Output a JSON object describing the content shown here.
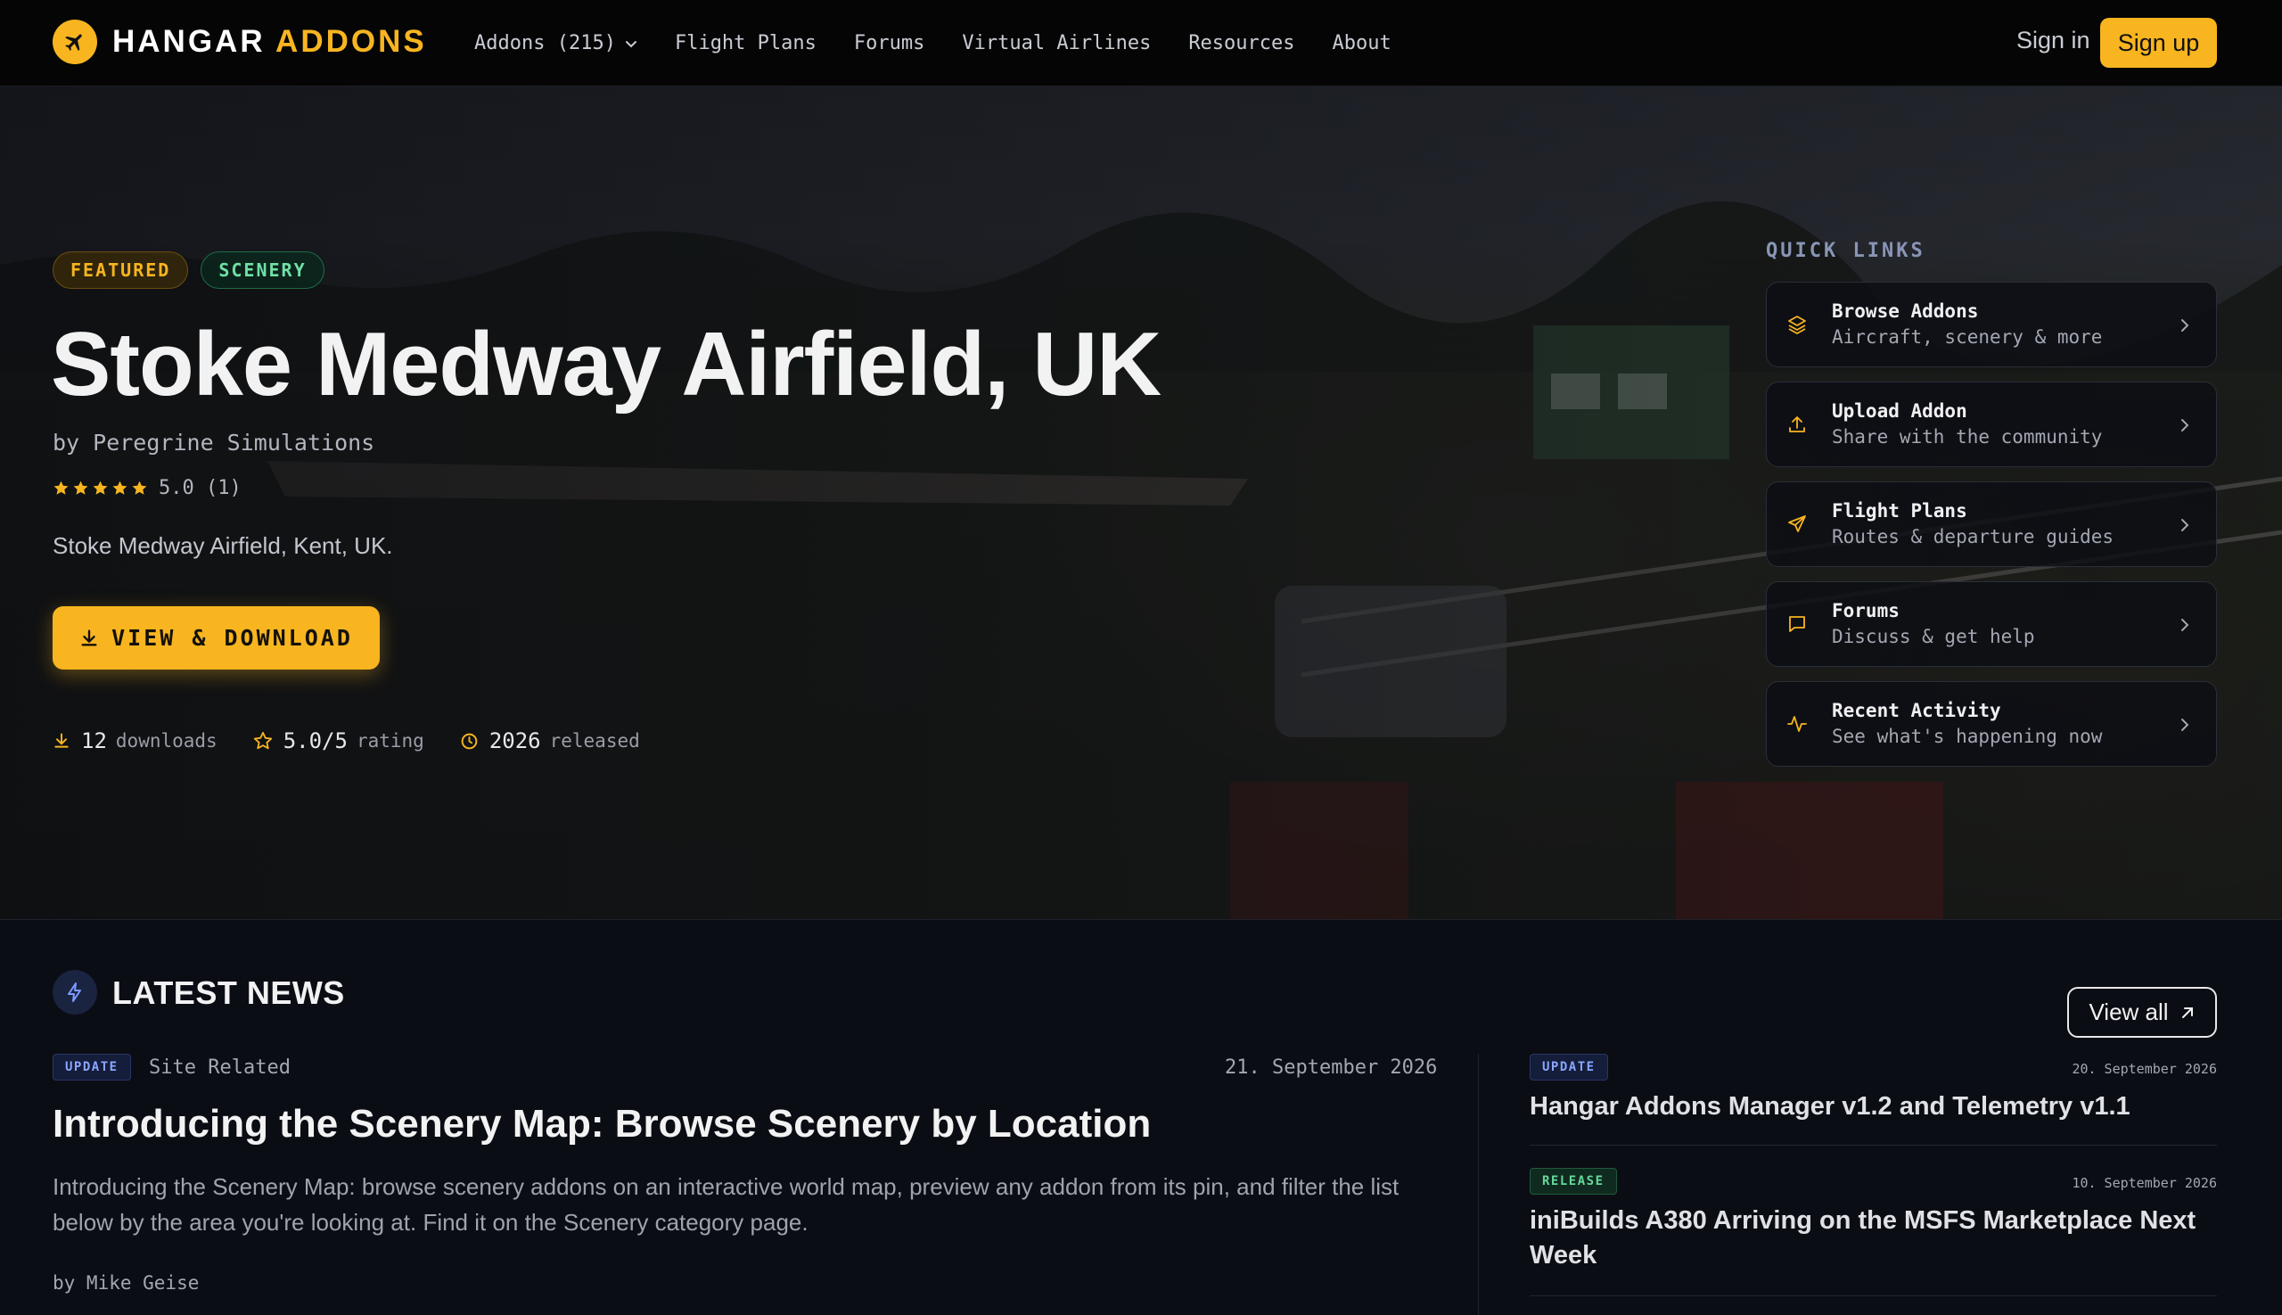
{
  "brand": {
    "word1": "HANGAR",
    "word2": "ADDONS"
  },
  "nav": {
    "items": [
      {
        "label": "Addons (215)",
        "has_dropdown": true
      },
      {
        "label": "Flight Plans"
      },
      {
        "label": "Forums"
      },
      {
        "label": "Virtual Airlines"
      },
      {
        "label": "Resources"
      },
      {
        "label": "About"
      }
    ],
    "signin": "Sign in",
    "signup": "Sign up"
  },
  "hero": {
    "badges": [
      "FEATURED",
      "SCENERY"
    ],
    "title": "Stoke Medway Airfield, UK",
    "author": "by Peregrine Simulations",
    "stars": 5,
    "rating_text": "5.0 (1)",
    "description": "Stoke Medway Airfield, Kent, UK.",
    "cta": "VIEW & DOWNLOAD",
    "stats": [
      {
        "icon": "download-icon",
        "value": "12",
        "label": "downloads"
      },
      {
        "icon": "star-outline-icon",
        "value": "5.0/5",
        "label": "rating"
      },
      {
        "icon": "clock-icon",
        "value": "2026",
        "label": "released"
      }
    ]
  },
  "quick_links": {
    "heading": "QUICK LINKS",
    "items": [
      {
        "icon": "layers-icon",
        "title": "Browse Addons",
        "subtitle": "Aircraft, scenery & more"
      },
      {
        "icon": "upload-icon",
        "title": "Upload Addon",
        "subtitle": "Share with the community"
      },
      {
        "icon": "send-icon",
        "title": "Flight Plans",
        "subtitle": "Routes & departure guides"
      },
      {
        "icon": "chat-icon",
        "title": "Forums",
        "subtitle": "Discuss & get help"
      },
      {
        "icon": "activity-icon",
        "title": "Recent Activity",
        "subtitle": "See what's happening now"
      }
    ]
  },
  "news": {
    "heading": "LATEST NEWS",
    "view_all": "View all",
    "main": {
      "tag": "UPDATE",
      "category": "Site Related",
      "date": "21. September 2026",
      "headline": "Introducing the Scenery Map: Browse Scenery by Location",
      "body": "Introducing the Scenery Map: browse scenery addons on an interactive world map, preview any addon from its pin, and filter the list below by the area you're looking at. Find it on the Scenery category page.",
      "author": "by Mike Geise"
    },
    "side": [
      {
        "tag": "UPDATE",
        "date": "20. September 2026",
        "headline": "Hangar Addons Manager v1.2 and Telemetry v1.1"
      },
      {
        "tag": "RELEASE",
        "date": "10. September 2026",
        "headline": "iniBuilds A380 Arriving on the MSFS Marketplace Next Week"
      }
    ]
  },
  "colors": {
    "accent": "#f8b520",
    "background": "#0b0d14",
    "nav": "#050505",
    "scenery_badge": "#6fe0a6",
    "update_tag": "#8aa6ff",
    "release_tag": "#66d79b"
  }
}
